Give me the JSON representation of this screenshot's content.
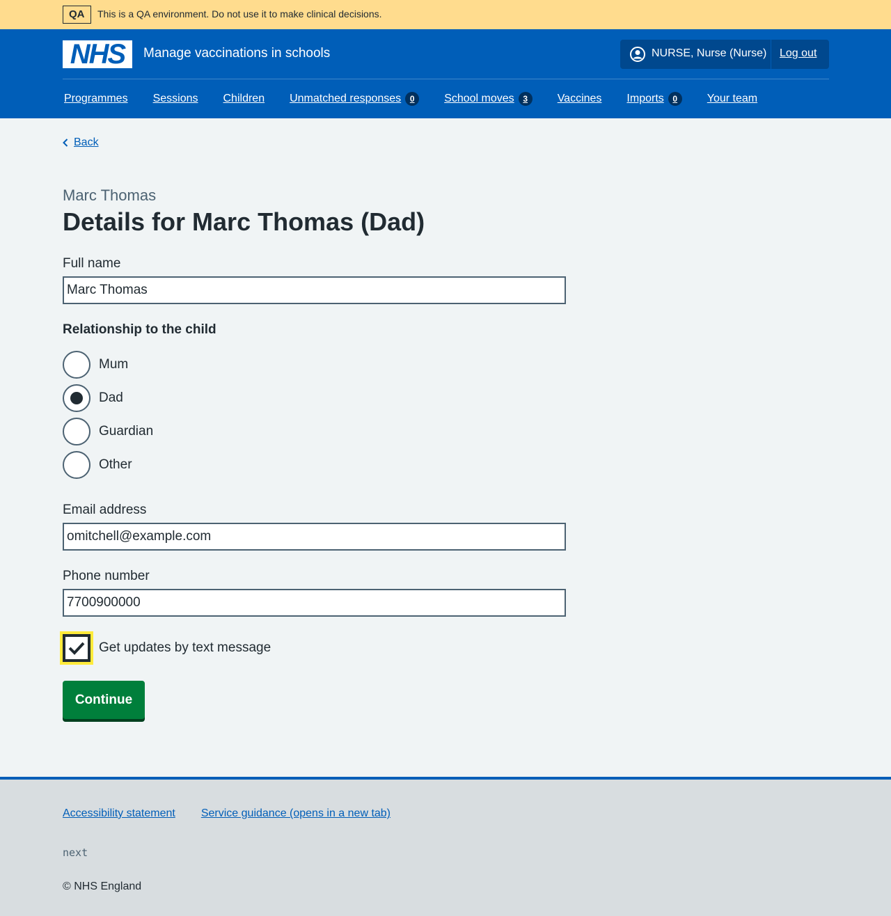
{
  "qa_banner": {
    "tag": "QA",
    "text": "This is a QA environment. Do not use it to make clinical decisions."
  },
  "header": {
    "logo": "NHS",
    "service_name": "Manage vaccinations in schools",
    "account_name": "NURSE, Nurse (Nurse)",
    "logout_label": "Log out"
  },
  "nav": {
    "items": [
      {
        "label": "Programmes"
      },
      {
        "label": "Sessions"
      },
      {
        "label": "Children"
      },
      {
        "label": "Unmatched responses",
        "badge": "0"
      },
      {
        "label": "School moves",
        "badge": "3"
      },
      {
        "label": "Vaccines"
      },
      {
        "label": "Imports",
        "badge": "0"
      },
      {
        "label": "Your team"
      }
    ]
  },
  "back_label": "Back",
  "page": {
    "caption": "Marc Thomas",
    "title": "Details for Marc Thomas (Dad)"
  },
  "form": {
    "full_name_label": "Full name",
    "full_name_value": "Marc Thomas",
    "relationship_legend": "Relationship to the child",
    "relationship_options": [
      {
        "label": "Mum",
        "checked": false
      },
      {
        "label": "Dad",
        "checked": true
      },
      {
        "label": "Guardian",
        "checked": false
      },
      {
        "label": "Other",
        "checked": false
      }
    ],
    "email_label": "Email address",
    "email_value": "omitchell@example.com",
    "phone_label": "Phone number",
    "phone_value": "7700900000",
    "sms_label": "Get updates by text message",
    "sms_checked": true,
    "continue_label": "Continue"
  },
  "footer": {
    "links": [
      "Accessibility statement",
      "Service guidance (opens in a new tab)"
    ],
    "env": "next",
    "copyright": "© NHS England"
  },
  "colors": {
    "nhs_blue": "#005eb8",
    "qa_banner": "#ffdc8e",
    "button_green": "#007f3b",
    "focus_yellow": "#ffeb3b"
  }
}
